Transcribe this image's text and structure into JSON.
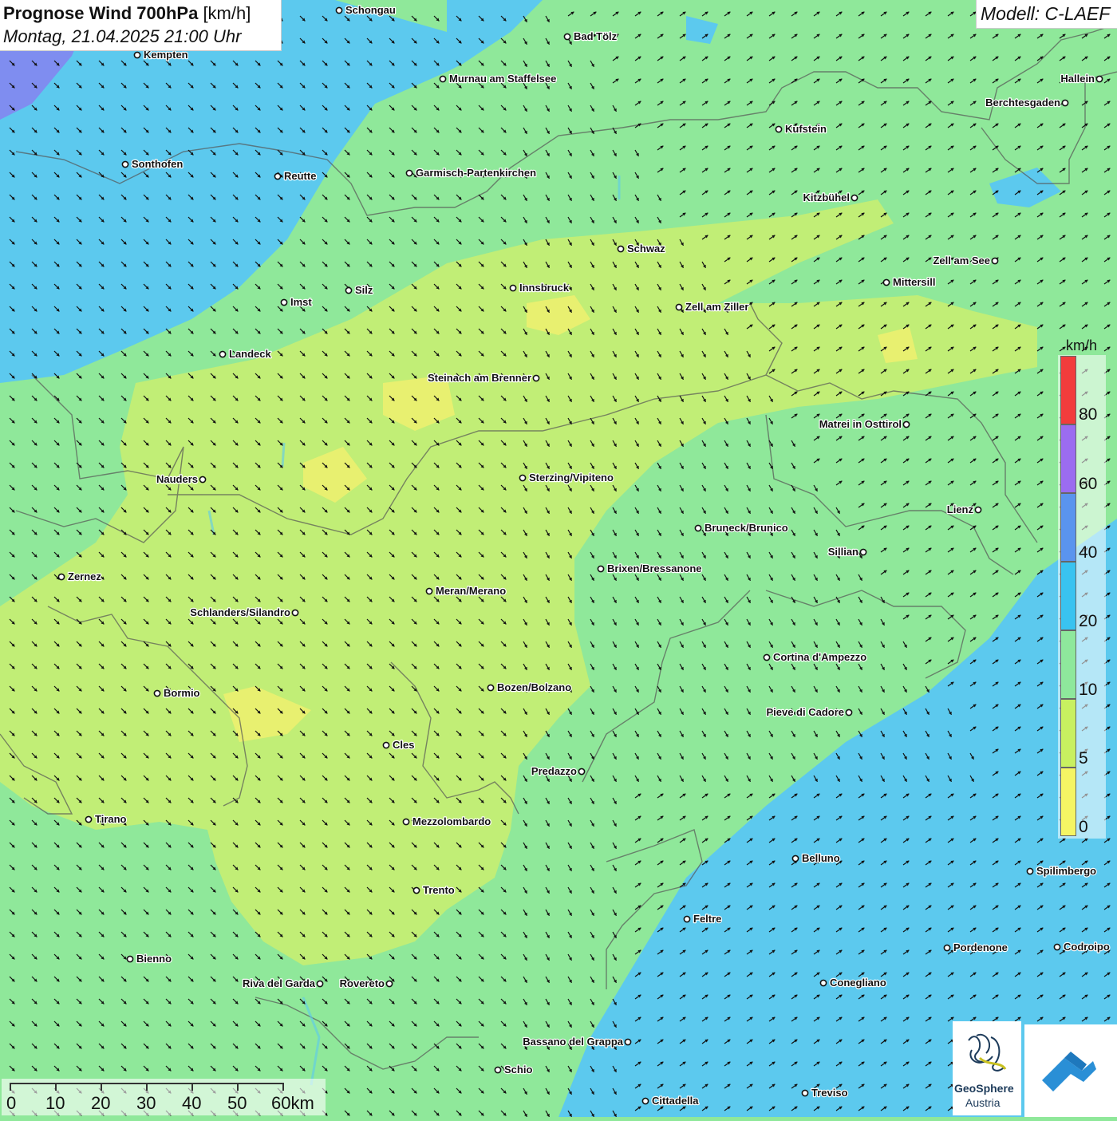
{
  "title": {
    "main": "Prognose Wind 700hPa",
    "unit": "[km/h]",
    "datetime": "Montag, 21.04.2025 21:00 Uhr"
  },
  "model": "Modell: C-LAEF",
  "legend": {
    "unit": "km/h",
    "bands": [
      {
        "label": "80",
        "color": "#f23c3c"
      },
      {
        "label": "60",
        "color": "#9b6cf0"
      },
      {
        "label": "40",
        "color": "#5a94ee"
      },
      {
        "label": "20",
        "color": "#39c3f0"
      },
      {
        "label": "10",
        "color": "#8ee89c"
      },
      {
        "label": "5",
        "color": "#c8f060"
      },
      {
        "label": "0",
        "color": "#f5f564"
      }
    ]
  },
  "scale": {
    "labels": [
      "0",
      "10",
      "20",
      "30",
      "40",
      "50",
      "60km"
    ]
  },
  "logos": {
    "org_line1": "GeoSphere",
    "org_line2": "Austria"
  },
  "cities": [
    {
      "name": "Schongau"
    },
    {
      "name": "Bad Tölz"
    },
    {
      "name": "Kempten"
    },
    {
      "name": "Murnau am Staffelsee"
    },
    {
      "name": "Hallein"
    },
    {
      "name": "Berchtesgaden"
    },
    {
      "name": "Kufstein"
    },
    {
      "name": "Sonthofen"
    },
    {
      "name": "Reutte"
    },
    {
      "name": "Garmisch-Partenkirchen"
    },
    {
      "name": "Kitzbühel"
    },
    {
      "name": "Schwaz"
    },
    {
      "name": "Zell am See"
    },
    {
      "name": "Mittersill"
    },
    {
      "name": "Imst"
    },
    {
      "name": "Silz"
    },
    {
      "name": "Innsbruck"
    },
    {
      "name": "Zell am Ziller"
    },
    {
      "name": "Landeck"
    },
    {
      "name": "Steinach am Brenner"
    },
    {
      "name": "Matrei in Osttirol"
    },
    {
      "name": "Nauders"
    },
    {
      "name": "Sterzing/Vipiteno"
    },
    {
      "name": "Lienz"
    },
    {
      "name": "Bruneck/Brunico"
    },
    {
      "name": "Sillian"
    },
    {
      "name": "Zernez"
    },
    {
      "name": "Brixen/Bressanone"
    },
    {
      "name": "Meran/Merano"
    },
    {
      "name": "Schlanders/Silandro"
    },
    {
      "name": "Cortina d'Ampezzo"
    },
    {
      "name": "Bozen/Bolzano"
    },
    {
      "name": "Bormio"
    },
    {
      "name": "Pieve di Cadore"
    },
    {
      "name": "Cles"
    },
    {
      "name": "Predazzo"
    },
    {
      "name": "Tirano"
    },
    {
      "name": "Mezzolombardo"
    },
    {
      "name": "Belluno"
    },
    {
      "name": "Spilimbergo"
    },
    {
      "name": "Trento"
    },
    {
      "name": "Feltre"
    },
    {
      "name": "Pordenone"
    },
    {
      "name": "Codroipo"
    },
    {
      "name": "Bienno"
    },
    {
      "name": "Riva del Garda"
    },
    {
      "name": "Rovereto"
    },
    {
      "name": "Conegliano"
    },
    {
      "name": "Bassano del Grappa"
    },
    {
      "name": "Schio"
    },
    {
      "name": "Treviso"
    },
    {
      "name": "Cittadella"
    }
  ]
}
